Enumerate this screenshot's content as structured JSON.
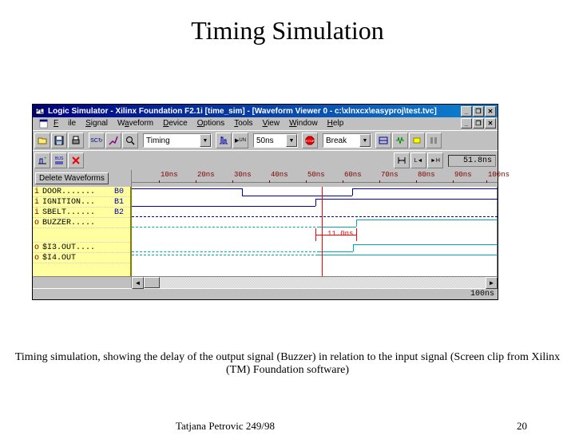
{
  "slide": {
    "title": "Timing Simulation",
    "caption": "Timing simulation, showing the delay of the output signal (Buzzer) in relation to the input signal (Screen clip from Xilinx (TM) Foundation software)",
    "author": "Tatjana Petrovic 249/98",
    "page": "20"
  },
  "window": {
    "title": "Logic Simulator - Xilinx Foundation F2.1i [time_sim] - [Waveform Viewer 0 - c:\\xlnxcx\\easyproj\\test.tvc]",
    "menu": {
      "file": "File",
      "signal": "Signal",
      "waveform": "Waveform",
      "device": "Device",
      "options": "Options",
      "tools": "Tools",
      "view": "View",
      "window": "Window",
      "help": "Help"
    },
    "mode_dd": "Timing",
    "step_dd": "50ns",
    "break_dd": "Break",
    "current_time": "51.8ns",
    "delete_button": "Delete Waveforms",
    "ruler": [
      "10ns",
      "20ns",
      "30ns",
      "40ns",
      "50ns",
      "60ns",
      "70ns",
      "80ns",
      "90ns",
      "100ns"
    ],
    "signals": [
      {
        "type": "i",
        "name": "DOOR.......",
        "eq": "B0"
      },
      {
        "type": "i",
        "name": "IGNITION...",
        "eq": "B1"
      },
      {
        "type": "i",
        "name": "SBELT......",
        "eq": "B2"
      },
      {
        "type": "o",
        "name": "BUZZER.....",
        "eq": ""
      }
    ],
    "outputs": [
      {
        "type": "o",
        "name": "$I3.OUT....",
        "eq": ""
      },
      {
        "type": "o",
        "name": "$I4.OUT",
        "eq": ""
      }
    ],
    "cursor_label": "11.0ns",
    "status_time": "100ns"
  }
}
